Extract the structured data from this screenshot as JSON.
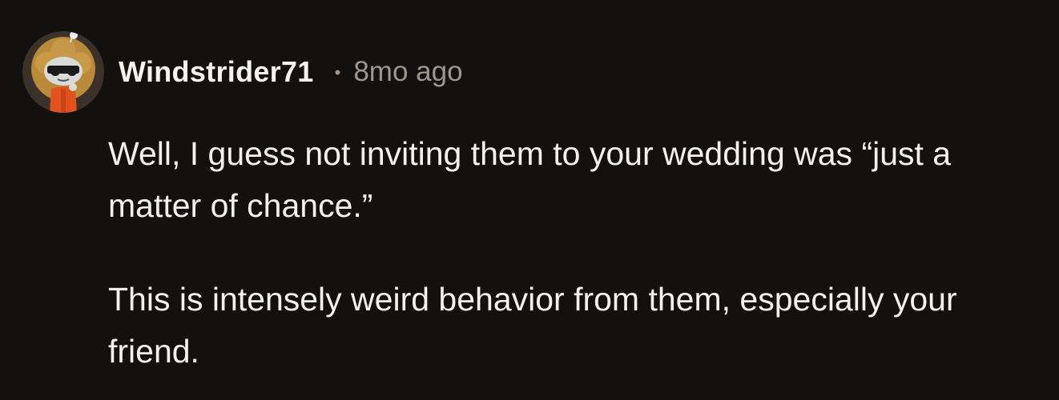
{
  "comment": {
    "author": "Windstrider71",
    "separator": "•",
    "timestamp": "8mo ago",
    "avatar_icon": "snoo-avatar-icon",
    "paragraphs": [
      "Well, I guess not inviting them to your wedding was “just a matter of chance.”",
      "This is intensely weird behavior from them, especially your friend."
    ]
  },
  "colors": {
    "background": "#131110",
    "text": "#f2f1ee",
    "meta": "#9c968f"
  }
}
